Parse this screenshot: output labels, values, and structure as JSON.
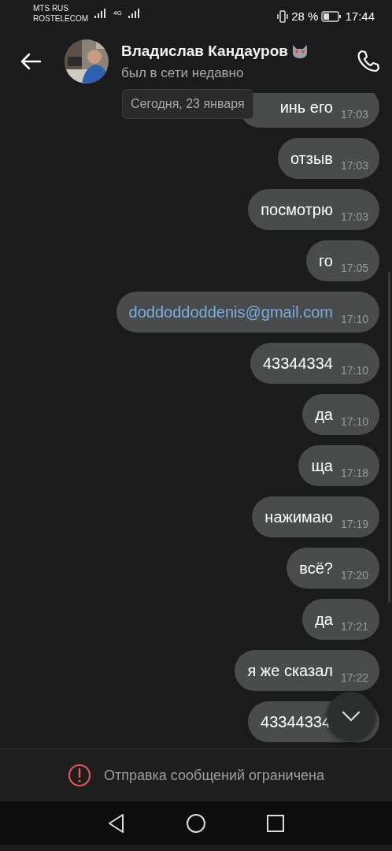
{
  "status_bar": {
    "carriers": [
      "MTS RUS",
      "ROSTELECOM"
    ],
    "network": "4G",
    "battery": "28 %",
    "time": "17:44"
  },
  "header": {
    "name": "Владислав Кандауров",
    "status": "был в сети недавно"
  },
  "date_pill": "Сегодня, 23 января",
  "messages": [
    {
      "kind": "text",
      "text": "инь его",
      "time": "17:03"
    },
    {
      "kind": "text",
      "text": "отзыв",
      "time": "17:03"
    },
    {
      "kind": "text",
      "text": "посмотрю",
      "time": "17:03"
    },
    {
      "kind": "text",
      "text": "го",
      "time": "17:05"
    },
    {
      "kind": "link",
      "text": "doddoddoddenis@gmail.com",
      "time": "17:10"
    },
    {
      "kind": "text",
      "text": "43344334",
      "time": "17:10"
    },
    {
      "kind": "text",
      "text": "да",
      "time": "17:10"
    },
    {
      "kind": "text",
      "text": "ща",
      "time": "17:18"
    },
    {
      "kind": "text",
      "text": "нажимаю",
      "time": "17:19"
    },
    {
      "kind": "text",
      "text": "всё?",
      "time": "17:20"
    },
    {
      "kind": "text",
      "text": "да",
      "time": "17:21"
    },
    {
      "kind": "text",
      "text": "я же сказал",
      "time": "17:22"
    },
    {
      "kind": "text",
      "text": "43344334"
    }
  ],
  "restriction": "Отправка сообщений ограничена"
}
